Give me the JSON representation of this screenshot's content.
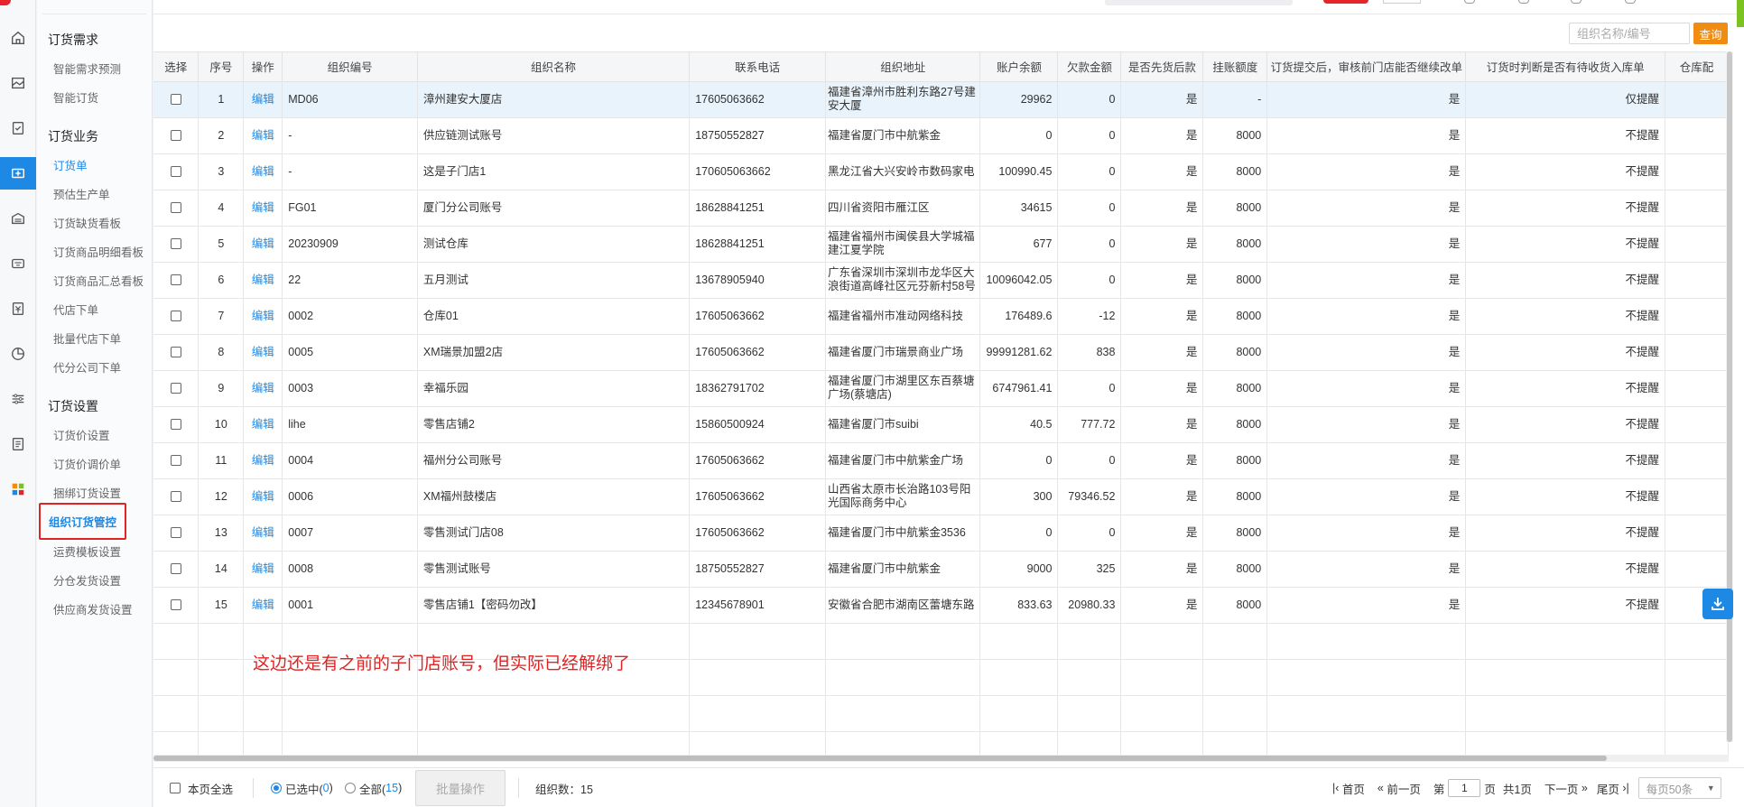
{
  "menu": {
    "groups": [
      {
        "title": "订货需求",
        "items": [
          "智能需求预测",
          "智能订货"
        ]
      },
      {
        "title": "订货业务",
        "items": [
          "订货单",
          "预估生产单",
          "订货缺货看板",
          "订货商品明细看板",
          "订货商品汇总看板",
          "代店下单",
          "批量代店下单",
          "代分公司下单"
        ]
      },
      {
        "title": "订货设置",
        "items": [
          "订货价设置",
          "订货价调价单",
          "捆绑订货设置",
          "组织订货管控",
          "运费模板设置",
          "分仓发货设置",
          "供应商发货设置"
        ]
      }
    ]
  },
  "filter": {
    "placeholder": "组织名称/编号",
    "query_label": "查询"
  },
  "table": {
    "headers": [
      "选择",
      "序号",
      "操作",
      "组织编号",
      "组织名称",
      "联系电话",
      "组织地址",
      "账户余额",
      "欠款金额",
      "是否先货后款",
      "挂账额度",
      "订货提交后，审核前门店能否继续改单",
      "订货时判断是否有待收货入库单",
      "仓库配"
    ],
    "edit_label": "编辑",
    "rows": [
      [
        "1",
        "MD06",
        "漳州建安大厦店",
        "17605063662",
        "福建省漳州市胜利东路27号建安大厦",
        "29962",
        "0",
        "是",
        "-",
        "是",
        "仅提醒"
      ],
      [
        "2",
        "-",
        "供应链测试账号",
        "18750552827",
        "福建省厦门市中航紫金",
        "0",
        "0",
        "是",
        "8000",
        "是",
        "不提醒"
      ],
      [
        "3",
        "-",
        "这是子门店1",
        "170605063662",
        "黑龙江省大兴安岭市数码家电",
        "100990.45",
        "0",
        "是",
        "8000",
        "是",
        "不提醒"
      ],
      [
        "4",
        "FG01",
        "厦门分公司账号",
        "18628841251",
        "四川省资阳市雁江区",
        "34615",
        "0",
        "是",
        "8000",
        "是",
        "不提醒"
      ],
      [
        "5",
        "20230909",
        "测试仓库",
        "18628841251",
        "福建省福州市闽侯县大学城福建江夏学院",
        "677",
        "0",
        "是",
        "8000",
        "是",
        "不提醒"
      ],
      [
        "6",
        "22",
        "五月测试",
        "13678905940",
        "广东省深圳市深圳市龙华区大浪街道高峰社区元芬新村58号",
        "10096042.05",
        "0",
        "是",
        "8000",
        "是",
        "不提醒"
      ],
      [
        "7",
        "0002",
        "仓库01",
        "17605063662",
        "福建省福州市准动网络科技",
        "176489.6",
        "-12",
        "是",
        "8000",
        "是",
        "不提醒"
      ],
      [
        "8",
        "0005",
        "XM瑞景加盟2店",
        "17605063662",
        "福建省厦门市瑞景商业广场",
        "99991281.62",
        "838",
        "是",
        "8000",
        "是",
        "不提醒"
      ],
      [
        "9",
        "0003",
        "幸福乐园",
        "18362791702",
        "福建省厦门市湖里区东百蔡塘广场(蔡塘店)",
        "6747961.41",
        "0",
        "是",
        "8000",
        "是",
        "不提醒"
      ],
      [
        "10",
        "lihe",
        "零售店铺2",
        "15860500924",
        "福建省厦门市suibi",
        "40.5",
        "777.72",
        "是",
        "8000",
        "是",
        "不提醒"
      ],
      [
        "11",
        "0004",
        "福州分公司账号",
        "17605063662",
        "福建省厦门市中航紫金广场",
        "0",
        "0",
        "是",
        "8000",
        "是",
        "不提醒"
      ],
      [
        "12",
        "0006",
        "XM福州鼓楼店",
        "17605063662",
        "山西省太原市长治路103号阳光国际商务中心",
        "300",
        "79346.52",
        "是",
        "8000",
        "是",
        "不提醒"
      ],
      [
        "13",
        "0007",
        "零售测试门店08",
        "17605063662",
        "福建省厦门市中航紫金3536",
        "0",
        "0",
        "是",
        "8000",
        "是",
        "不提醒"
      ],
      [
        "14",
        "0008",
        "零售测试账号",
        "18750552827",
        "福建省厦门市中航紫金",
        "9000",
        "325",
        "是",
        "8000",
        "是",
        "不提醒"
      ],
      [
        "15",
        "0001",
        "零售店铺1【密码勿改】",
        "12345678901",
        "安徽省合肥市湖南区蕾塘东路",
        "833.63",
        "20980.33",
        "是",
        "8000",
        "是",
        "不提醒"
      ]
    ]
  },
  "annotation": "这边还是有之前的子门店账号，但实际已经解绑了",
  "footer": {
    "select_page": "本页全选",
    "selected_prefix": "已选中(",
    "selected_count": "0",
    "all_prefix": "全部(",
    "all_count": "15",
    "close_paren": ")",
    "batch_label": "批量操作",
    "org_count": "组织数：15",
    "first": "首页",
    "prev": "前一页",
    "page_prefix": "第",
    "page_value": "1",
    "page_suffix": "页",
    "total_pages": "共1页",
    "next": "下一页",
    "last": "尾页",
    "per_page": "每页50条"
  },
  "icons": [
    "home-icon",
    "image-icon",
    "check-doc-icon",
    "order-icon",
    "shop-icon",
    "card-icon",
    "money-icon",
    "chart-icon",
    "sliders-icon",
    "report-icon",
    "apps-icon",
    "download-icon"
  ],
  "colors": {
    "accent": "#1e88e5",
    "query": "#f08c12",
    "annotation": "#e02424",
    "apps": [
      "#f08c12",
      "#7cc321",
      "#1e88e5",
      "#e5252a"
    ]
  }
}
